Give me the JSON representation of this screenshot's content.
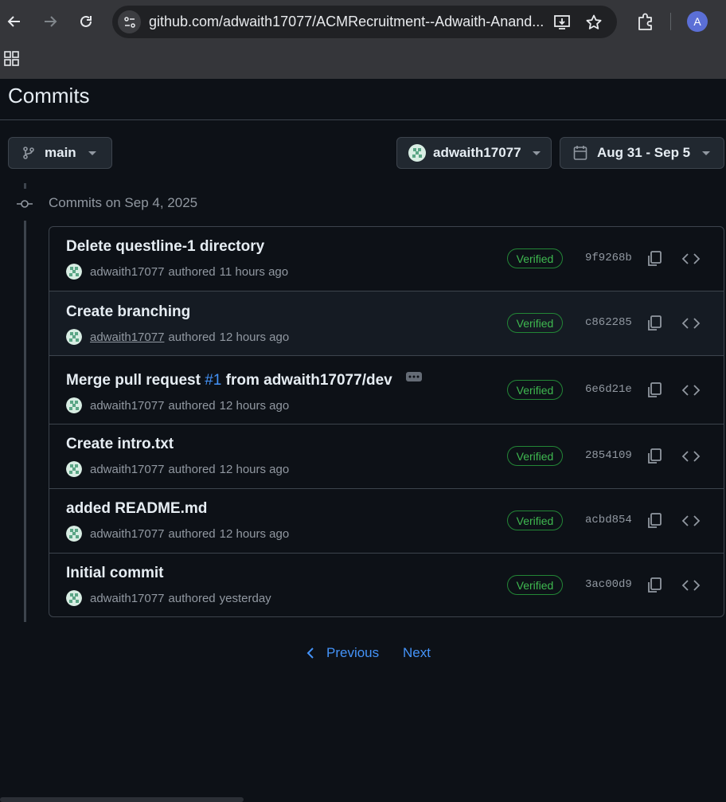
{
  "browser": {
    "url": "github.com/adwaith17077/ACMRecruitment--Adwaith-Anand...",
    "profile_initial": "A"
  },
  "page": {
    "title": "Commits"
  },
  "filters": {
    "branch": "main",
    "user": "adwaith17077",
    "date_range": "Aug 31 - Sep 5"
  },
  "group": {
    "title": "Commits on Sep 4, 2025"
  },
  "commits": [
    {
      "title": "Delete questline-1 directory",
      "author": "adwaith17077",
      "authored": "authored",
      "time": "11 hours ago",
      "badge": "Verified",
      "sha": "9f9268b"
    },
    {
      "title": "Create branching",
      "author": "adwaith17077",
      "authored": "authored",
      "time": "12 hours ago",
      "badge": "Verified",
      "sha": "c862285"
    },
    {
      "title_prefix": "Merge pull request",
      "pr": "#1",
      "title_suffix": "from adwaith17077/dev",
      "author": "adwaith17077",
      "authored": "authored",
      "time": "12 hours ago",
      "badge": "Verified",
      "sha": "6e6d21e"
    },
    {
      "title": "Create intro.txt",
      "author": "adwaith17077",
      "authored": "authored",
      "time": "12 hours ago",
      "badge": "Verified",
      "sha": "2854109"
    },
    {
      "title": "added README.md",
      "author": "adwaith17077",
      "authored": "authored",
      "time": "12 hours ago",
      "badge": "Verified",
      "sha": "acbd854"
    },
    {
      "title": "Initial commit",
      "author": "adwaith17077",
      "authored": "authored",
      "time": "yesterday",
      "badge": "Verified",
      "sha": "3ac00d9"
    }
  ],
  "pagination": {
    "previous": "Previous",
    "next": "Next"
  },
  "colors": {
    "background": "#0d1117",
    "accent_link": "#4493f8",
    "verified": "#3fb950"
  },
  "icons": [
    "back-icon",
    "forward-icon",
    "reload-icon",
    "site-info-icon",
    "install-icon",
    "star-icon",
    "extensions-icon",
    "apps-icon",
    "branch-icon",
    "calendar-icon",
    "commit-node-icon",
    "copy-icon",
    "code-icon",
    "chevron-left-icon"
  ]
}
